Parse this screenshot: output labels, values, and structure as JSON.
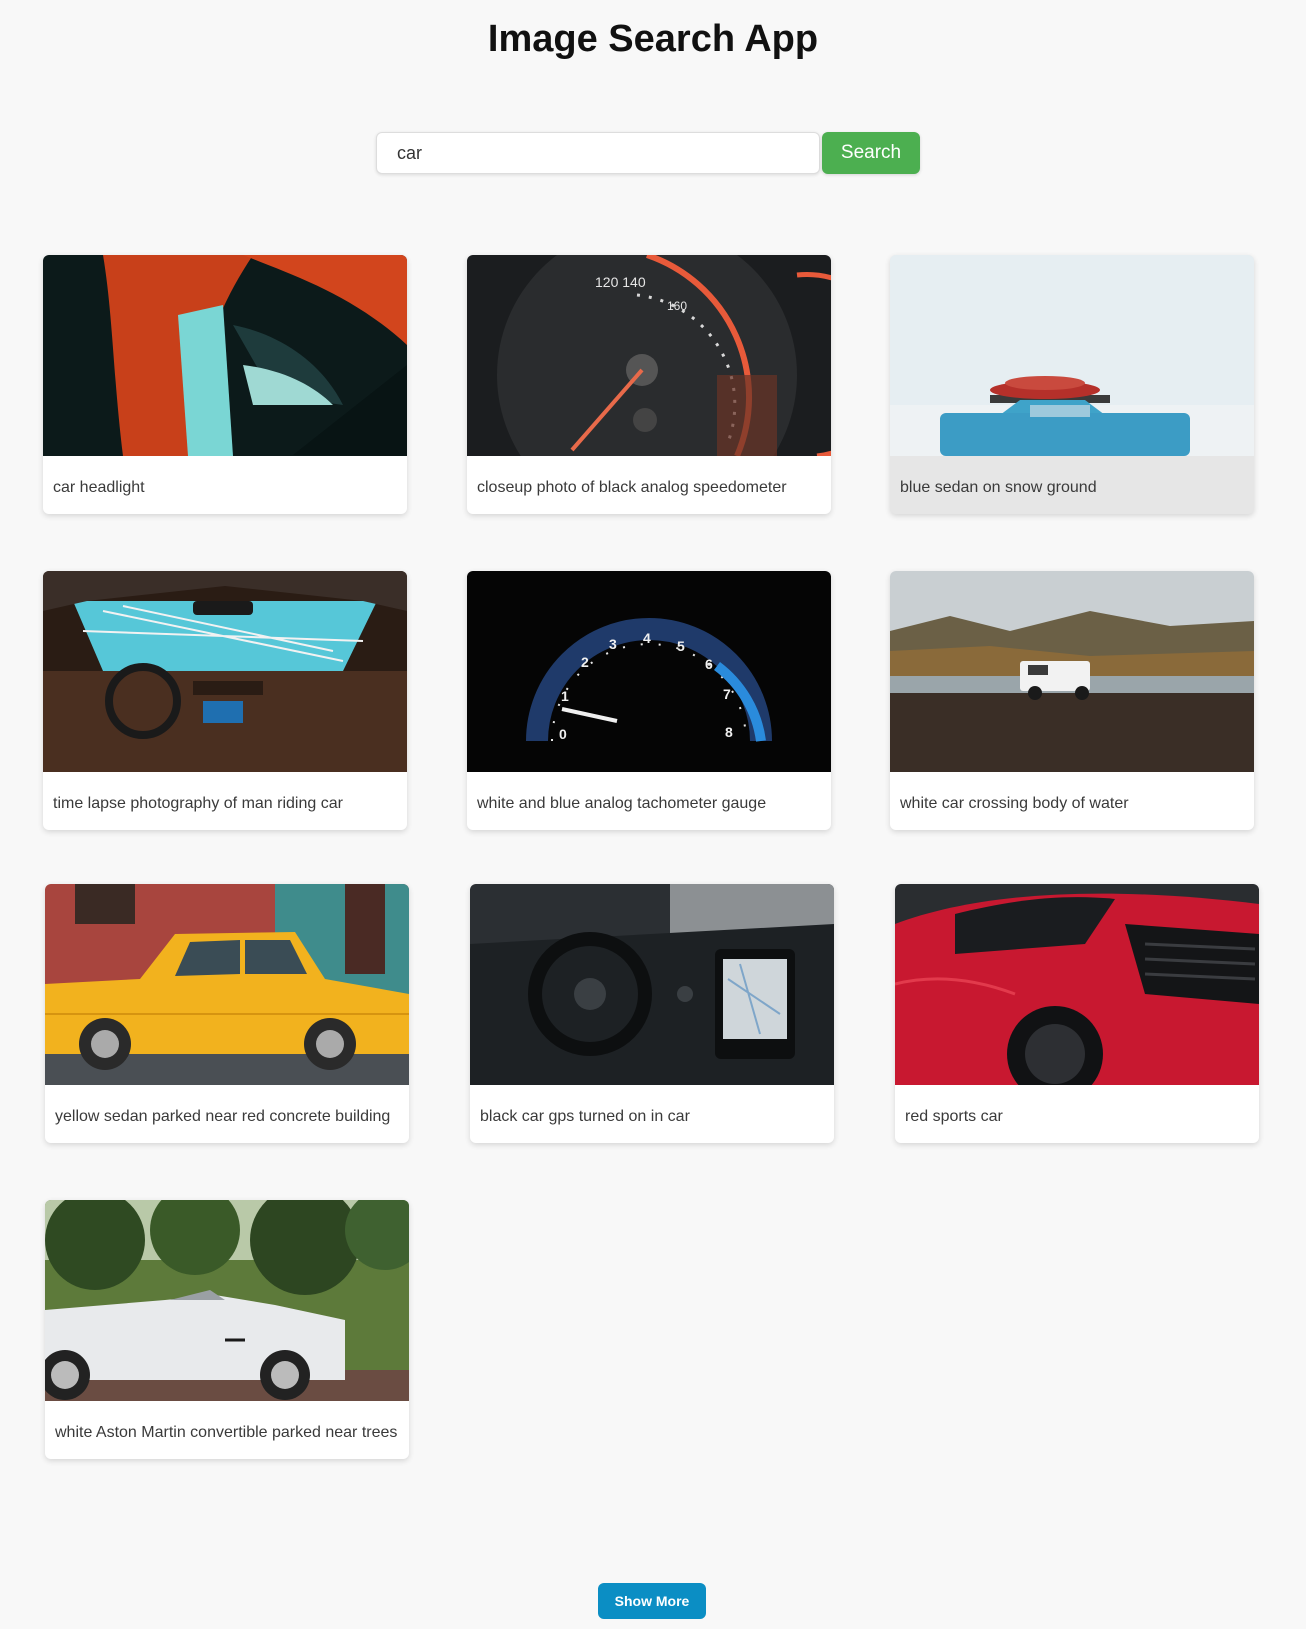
{
  "app": {
    "title": "Image Search App"
  },
  "search": {
    "value": "car",
    "button_label": "Search"
  },
  "results": [
    {
      "caption": "car headlight",
      "icon": "car-headlight-photo"
    },
    {
      "caption": "closeup photo of black analog speedometer",
      "icon": "speedometer-photo"
    },
    {
      "caption": "blue sedan on snow ground",
      "icon": "blue-sedan-snow-photo"
    },
    {
      "caption": "time lapse photography of man riding car",
      "icon": "car-interior-timelapse-photo"
    },
    {
      "caption": "white and blue analog tachometer gauge",
      "icon": "tachometer-photo"
    },
    {
      "caption": "white car crossing body of water",
      "icon": "white-suv-water-photo"
    },
    {
      "caption": "yellow sedan parked near red concrete building",
      "icon": "yellow-sedan-photo"
    },
    {
      "caption": "black car gps turned on in car",
      "icon": "car-dashboard-gps-photo"
    },
    {
      "caption": "red sports car",
      "icon": "red-sports-car-photo"
    },
    {
      "caption": "white Aston Martin convertible parked near trees",
      "icon": "white-convertible-photo"
    }
  ],
  "pagination": {
    "show_more_label": "Show More"
  },
  "colors": {
    "page_background": "#f8f8f8",
    "search_button": "#4caf50",
    "show_more_button": "#0b8ec4",
    "hovered_card": "#e6e6e6"
  }
}
